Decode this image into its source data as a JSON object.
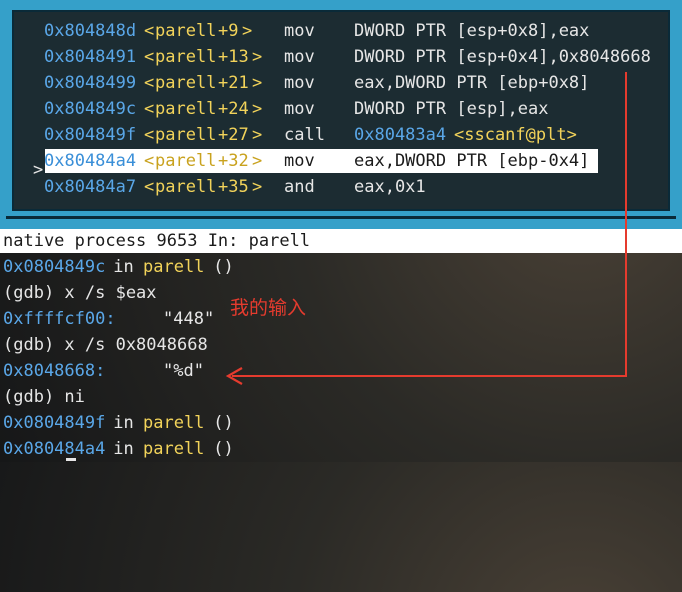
{
  "disassembly": {
    "cursor_marker": ">",
    "rows": [
      {
        "addr": "0x804848d",
        "lt": "<",
        "sym": "parell",
        "off": "+9",
        "gt": ">",
        "op": "mov",
        "args": "DWORD PTR [esp+0x8],eax"
      },
      {
        "addr": "0x8048491",
        "lt": "<",
        "sym": "parell",
        "off": "+13",
        "gt": ">",
        "op": "mov",
        "args": "DWORD PTR [esp+0x4],0x8048668"
      },
      {
        "addr": "0x8048499",
        "lt": "<",
        "sym": "parell",
        "off": "+21",
        "gt": ">",
        "op": "mov",
        "args": "eax,DWORD PTR [ebp+0x8]"
      },
      {
        "addr": "0x804849c",
        "lt": "<",
        "sym": "parell",
        "off": "+24",
        "gt": ">",
        "op": "mov",
        "args": "DWORD PTR [esp],eax"
      },
      {
        "addr": "0x804849f",
        "lt": "<",
        "sym": "parell",
        "off": "+27",
        "gt": ">",
        "op": "call",
        "target": "0x80483a4",
        "callee": "<sscanf@plt>"
      },
      {
        "addr": "0x80484a4",
        "lt": "<",
        "sym": "parell",
        "off": "+32",
        "gt": ">",
        "op": "mov",
        "args": "eax,DWORD PTR [ebp-0x4]",
        "current": true
      },
      {
        "addr": "0x80484a7",
        "lt": "<",
        "sym": "parell",
        "off": "+35",
        "gt": ">",
        "op": "and",
        "args": "eax,0x1"
      }
    ]
  },
  "status_bar": {
    "text": "native process 9653 In: parell"
  },
  "console": {
    "lines": [
      {
        "addr": "0x0804849c",
        "mid": " in ",
        "func": "parell",
        "tail": " ()"
      },
      {
        "text": "(gdb) x /s $eax"
      },
      {
        "addr": "0xffffcf00:",
        "value": "\"448\""
      },
      {
        "text": "(gdb) x /s 0x8048668"
      },
      {
        "addr": "0x8048668:",
        "value": "\"%d\""
      },
      {
        "text": "(gdb) ni"
      },
      {
        "addr": "0x0804849f",
        "mid": " in ",
        "func": "parell",
        "tail": " ()"
      },
      {
        "addr": "0x080484a4",
        "mid": " in ",
        "func": "parell",
        "tail": " ()"
      }
    ]
  },
  "annotation": {
    "text": "我的输入",
    "color": "#e53b2e"
  },
  "colors": {
    "tui_border": "#35a0c9",
    "address": "#5aa7e8",
    "symbol": "#f2d35a",
    "current_line_bg": "#ffffff"
  }
}
